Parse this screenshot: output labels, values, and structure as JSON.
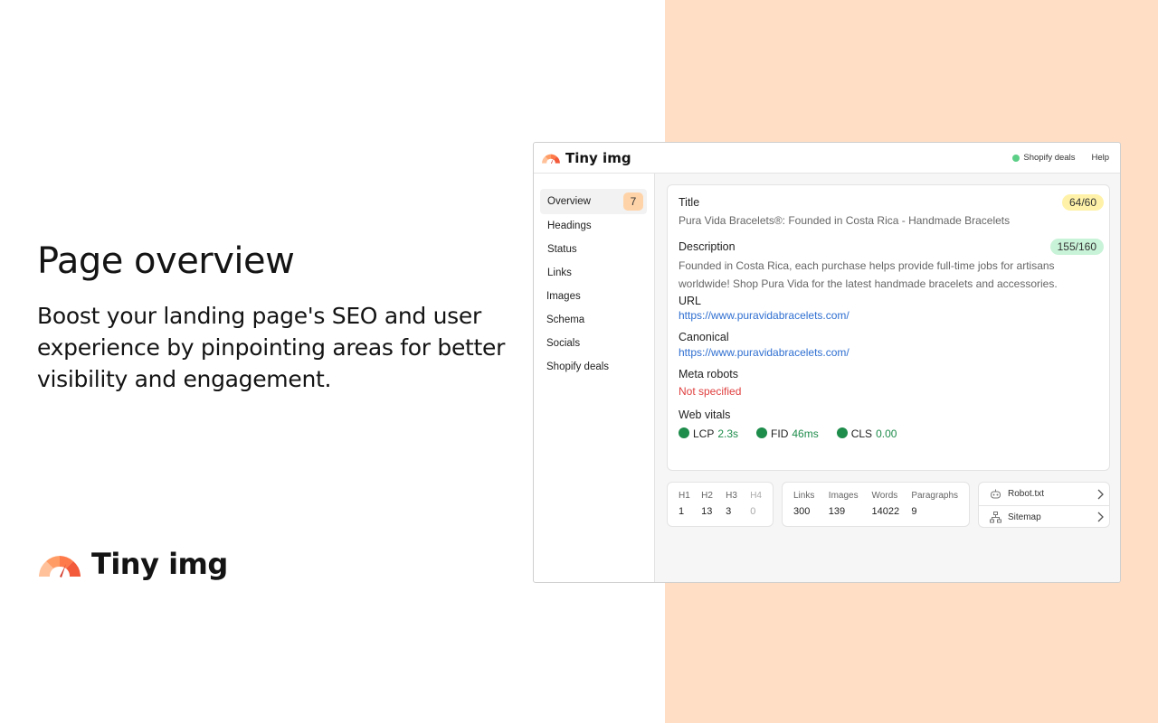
{
  "hero": {
    "title": "Page overview",
    "text": "Boost your landing page's SEO and user experience by pinpointing areas for better visibility and engagement."
  },
  "brand": {
    "name": "Tiny img"
  },
  "window": {
    "brand_name": "Tiny img",
    "header": {
      "deals_label": "Shopify deals",
      "help_label": "Help"
    },
    "sidebar": {
      "items": [
        {
          "label": "Overview",
          "badge": "7"
        },
        {
          "label": "Headings"
        },
        {
          "label": "Status"
        },
        {
          "label": "Links"
        },
        {
          "label": "Images"
        },
        {
          "label": "Schema"
        },
        {
          "label": "Socials"
        },
        {
          "label": "Shopify deals"
        }
      ]
    },
    "overview": {
      "title_label": "Title",
      "title_count": "64/60",
      "title_value": "Pura Vida Bracelets®: Founded in Costa Rica - Handmade Bracelets",
      "description_label": "Description",
      "description_count": "155/160",
      "description_value": "Founded in Costa Rica, each purchase helps provide full-time jobs for artisans worldwide! Shop Pura Vida for the latest handmade bracelets and accessories.",
      "url_label": "URL",
      "url_value": "https://www.puravidabracelets.com/",
      "canonical_label": "Canonical",
      "canonical_value": "https://www.puravidabracelets.com/",
      "meta_robots_label": "Meta robots",
      "meta_robots_value": "Not specified",
      "web_vitals_label": "Web vitals",
      "vitals": [
        {
          "name": "LCP",
          "value": "2.3s"
        },
        {
          "name": "FID",
          "value": "46ms"
        },
        {
          "name": "CLS",
          "value": "0.00"
        }
      ]
    },
    "headings_stats": [
      {
        "label": "H1",
        "value": "1"
      },
      {
        "label": "H2",
        "value": "13"
      },
      {
        "label": "H3",
        "value": "3"
      },
      {
        "label": "H4",
        "value": "0"
      }
    ],
    "content_stats": [
      {
        "label": "Links",
        "value": "300"
      },
      {
        "label": "Images",
        "value": "139"
      },
      {
        "label": "Words",
        "value": "14022"
      },
      {
        "label": "Paragraphs",
        "value": "9"
      }
    ],
    "quick_links": [
      {
        "label": "Robot.txt",
        "icon": "robot-icon"
      },
      {
        "label": "Sitemap",
        "icon": "sitemap-icon"
      }
    ]
  },
  "colors": {
    "peach_background": "#ffdec5",
    "accent_green": "#1e8c4b",
    "link_blue": "#2f6fd1",
    "warn_red": "#e04040",
    "badge_orange": "#ffd3a8"
  }
}
